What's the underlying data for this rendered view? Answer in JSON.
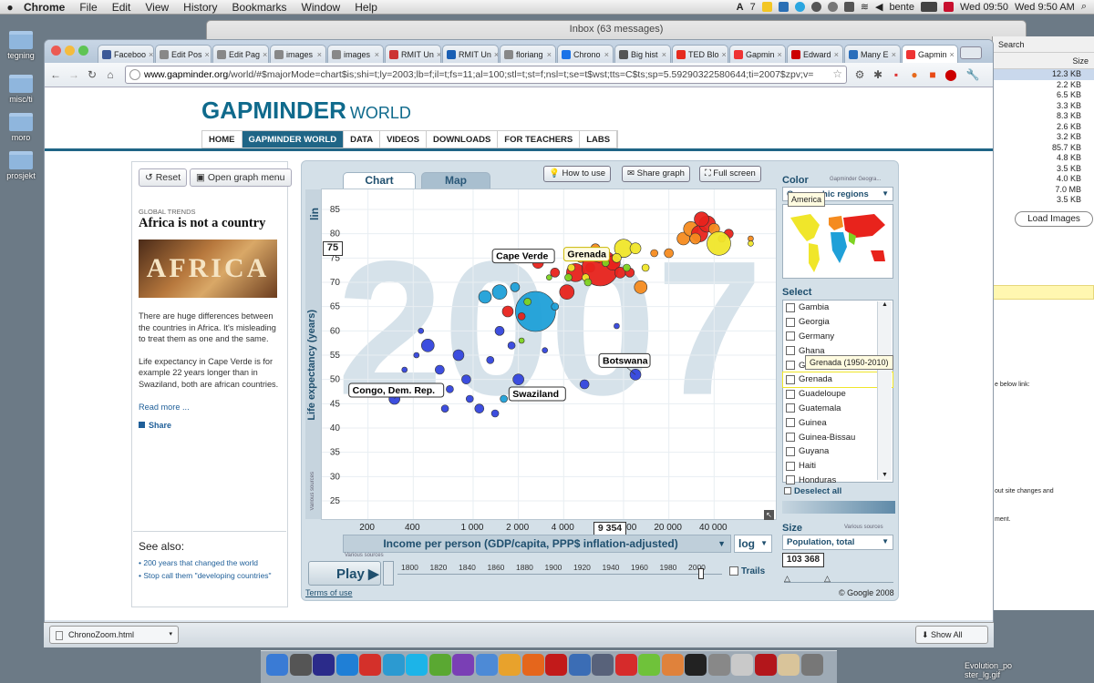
{
  "menubar": {
    "apple": "",
    "app": "Chrome",
    "items": [
      "File",
      "Edit",
      "View",
      "History",
      "Bookmarks",
      "Window",
      "Help"
    ],
    "user": "bente",
    "clock1": "Wed 09:50",
    "clock2": "Wed 9:50 AM",
    "ai_badge": "7"
  },
  "desktop": {
    "icons": [
      "tegning",
      "misc/ti",
      "moro",
      "prosjekt"
    ]
  },
  "inbox_window": {
    "title": "Inbox (63 messages)"
  },
  "finder": {
    "search": "Search",
    "size_header": "Size",
    "sizes": [
      "12.3 KB",
      "2.2 KB",
      "6.5 KB",
      "3.3 KB",
      "8.3 KB",
      "2.6 KB",
      "3.2 KB",
      "85.7 KB",
      "4.8 KB",
      "3.5 KB",
      "4.0 KB",
      "7.0 MB",
      "3.5 KB"
    ],
    "load_images": "Load Images",
    "below_link": "e below link:",
    "site_changes": "out site changes and",
    "ment": "ment.",
    "evolution": "Evolution_po\nster_lg.gif"
  },
  "tabs": [
    {
      "label": "Faceboo",
      "color": "#3b5998"
    },
    {
      "label": "Edit Pos",
      "color": "#888"
    },
    {
      "label": "Edit Pag",
      "color": "#888"
    },
    {
      "label": "images",
      "color": "#888"
    },
    {
      "label": "images",
      "color": "#888"
    },
    {
      "label": "RMIT Un",
      "color": "#c33"
    },
    {
      "label": "RMIT Un",
      "color": "#1a5fb4"
    },
    {
      "label": "floriang",
      "color": "#888"
    },
    {
      "label": "Chrono",
      "color": "#1a73e8"
    },
    {
      "label": "Big hist",
      "color": "#555"
    },
    {
      "label": "TED Blo",
      "color": "#e62b1e"
    },
    {
      "label": "Gapmin",
      "color": "#e33"
    },
    {
      "label": "Edward",
      "color": "#c00"
    },
    {
      "label": "Many E",
      "color": "#2a6ebb"
    },
    {
      "label": "Gapmin",
      "color": "#e33"
    }
  ],
  "url": {
    "host": "www.gapminder.org",
    "path": "/world/#$majorMode=chart$is;shi=t;ly=2003;lb=f;il=t;fs=11;al=100;stl=t;st=f;nsl=t;se=t$wst;tts=C$ts;sp=5.59290322580644;ti=2007$zpv;v="
  },
  "site": {
    "logo_bold": "GAPMINDER",
    "logo_light": "WORLD",
    "nav": [
      "HOME",
      "GAPMINDER WORLD",
      "DATA",
      "VIDEOS",
      "DOWNLOADS",
      "FOR TEACHERS",
      "LABS"
    ]
  },
  "left": {
    "reset": "Reset",
    "open_menu": "Open graph menu",
    "global_trends": "GLOBAL TRENDS",
    "headline": "Africa is not a country",
    "image_text": "AFRICA",
    "p1": "There are huge differences between the countries in Africa. It's misleading to treat them as one and the same.",
    "p2": "Life expectancy in Cape Verde is for example 22 years longer than in Swaziland, both are african countries.",
    "read_more": "Read more ...",
    "share": "Share",
    "see_also": "See also:",
    "links": [
      "200 years that changed the world",
      "Stop call them \"developing countries\""
    ],
    "terms": "Terms of use"
  },
  "graph": {
    "tab_chart": "Chart",
    "tab_map": "Map",
    "how_to_use": "How to use",
    "share_graph": "Share graph",
    "full_screen": "Full screen",
    "y_scale": "lin",
    "y_label": "Life expectancy (years)",
    "x_label": "Income per person (GDP/capita, PPP$ inflation-adjusted)",
    "x_scale": "log",
    "y_readout": "75",
    "x_readout": "9 354",
    "various_sources": "Various sources",
    "year": "2007",
    "play": "Play",
    "trails": "Trails",
    "timeline_ticks": [
      "1800",
      "1820",
      "1840",
      "1860",
      "1880",
      "1900",
      "1920",
      "1940",
      "1960",
      "1980",
      "2000"
    ],
    "copyright": "© Google 2008"
  },
  "chart_data": {
    "type": "scatter",
    "title": "",
    "xlabel": "Income per person (GDP/capita, PPP$ inflation-adjusted)",
    "ylabel": "Life expectancy (years)",
    "x_scale": "log",
    "xlim": [
      150,
      80000
    ],
    "ylim": [
      22,
      88
    ],
    "x_ticks": [
      "200",
      "400",
      "1 000",
      "2 000",
      "4 000",
      "10 000",
      "20 000",
      "40 000"
    ],
    "y_ticks": [
      "25",
      "30",
      "35",
      "40",
      "45",
      "50",
      "55",
      "60",
      "65",
      "70",
      "75",
      "80",
      "85"
    ],
    "year": "2007",
    "labels": [
      {
        "name": "Cape Verde",
        "x": 2700,
        "y": 74
      },
      {
        "name": "Grenada",
        "x": 7000,
        "y": 74
      },
      {
        "name": "Botswana",
        "x": 12000,
        "y": 51
      },
      {
        "name": "Swaziland",
        "x": 4000,
        "y": 46
      },
      {
        "name": "Congo, Dem. Rep.",
        "x": 300,
        "y": 46
      }
    ],
    "points": [
      {
        "x": 300,
        "y": 46,
        "r": 6,
        "c": "#3344dd"
      },
      {
        "x": 350,
        "y": 52,
        "r": 3,
        "c": "#3344dd"
      },
      {
        "x": 420,
        "y": 55,
        "r": 3,
        "c": "#3344dd"
      },
      {
        "x": 500,
        "y": 57,
        "r": 7,
        "c": "#3344dd"
      },
      {
        "x": 520,
        "y": 48,
        "r": 4,
        "c": "#3344dd"
      },
      {
        "x": 600,
        "y": 52,
        "r": 5,
        "c": "#3344dd"
      },
      {
        "x": 700,
        "y": 48,
        "r": 4,
        "c": "#3344dd"
      },
      {
        "x": 800,
        "y": 55,
        "r": 6,
        "c": "#3344dd"
      },
      {
        "x": 900,
        "y": 50,
        "r": 5,
        "c": "#3344dd"
      },
      {
        "x": 950,
        "y": 46,
        "r": 4,
        "c": "#3344dd"
      },
      {
        "x": 1100,
        "y": 44,
        "r": 5,
        "c": "#3344dd"
      },
      {
        "x": 650,
        "y": 44,
        "r": 4,
        "c": "#3344dd"
      },
      {
        "x": 450,
        "y": 60,
        "r": 3,
        "c": "#3344dd"
      },
      {
        "x": 1300,
        "y": 54,
        "r": 4,
        "c": "#3344dd"
      },
      {
        "x": 1500,
        "y": 60,
        "r": 5,
        "c": "#3344dd"
      },
      {
        "x": 1800,
        "y": 57,
        "r": 4,
        "c": "#3344dd"
      },
      {
        "x": 1400,
        "y": 43,
        "r": 4,
        "c": "#3344dd"
      },
      {
        "x": 2000,
        "y": 50,
        "r": 6,
        "c": "#3344dd"
      },
      {
        "x": 3000,
        "y": 56,
        "r": 3,
        "c": "#3344dd"
      },
      {
        "x": 5500,
        "y": 49,
        "r": 5,
        "c": "#3344dd"
      },
      {
        "x": 9000,
        "y": 61,
        "r": 3,
        "c": "#3344dd"
      },
      {
        "x": 12000,
        "y": 51,
        "r": 6,
        "c": "#3344dd"
      },
      {
        "x": 1600,
        "y": 46,
        "r": 4,
        "c": "#1fa0d8"
      },
      {
        "x": 1200,
        "y": 67,
        "r": 7,
        "c": "#1fa0d8"
      },
      {
        "x": 1500,
        "y": 68,
        "r": 8,
        "c": "#1fa0d8"
      },
      {
        "x": 2600,
        "y": 64,
        "r": 22,
        "c": "#1fa0d8"
      },
      {
        "x": 1900,
        "y": 69,
        "r": 5,
        "c": "#1fa0d8"
      },
      {
        "x": 3500,
        "y": 65,
        "r": 4,
        "c": "#1fa0d8"
      },
      {
        "x": 1700,
        "y": 64,
        "r": 6,
        "c": "#e8231c"
      },
      {
        "x": 2100,
        "y": 63,
        "r": 4,
        "c": "#e8231c"
      },
      {
        "x": 2700,
        "y": 74,
        "r": 6,
        "c": "#e8231c"
      },
      {
        "x": 3500,
        "y": 72,
        "r": 5,
        "c": "#e8231c"
      },
      {
        "x": 4200,
        "y": 68,
        "r": 8,
        "c": "#e8231c"
      },
      {
        "x": 4800,
        "y": 72,
        "r": 10,
        "c": "#e8231c"
      },
      {
        "x": 6000,
        "y": 73,
        "r": 5,
        "c": "#e8231c"
      },
      {
        "x": 7000,
        "y": 73,
        "r": 20,
        "c": "#e8231c"
      },
      {
        "x": 8500,
        "y": 74,
        "r": 8,
        "c": "#e8231c"
      },
      {
        "x": 9500,
        "y": 72,
        "r": 6,
        "c": "#e8231c"
      },
      {
        "x": 11000,
        "y": 72,
        "r": 5,
        "c": "#e8231c"
      },
      {
        "x": 13000,
        "y": 69,
        "r": 7,
        "c": "#f58b1f"
      },
      {
        "x": 5200,
        "y": 75,
        "r": 5,
        "c": "#f58b1f"
      },
      {
        "x": 6500,
        "y": 77,
        "r": 5,
        "c": "#f58b1f"
      },
      {
        "x": 16000,
        "y": 76,
        "r": 4,
        "c": "#f58b1f"
      },
      {
        "x": 20000,
        "y": 76,
        "r": 5,
        "c": "#f58b1f"
      },
      {
        "x": 25000,
        "y": 79,
        "r": 7,
        "c": "#f58b1f"
      },
      {
        "x": 28000,
        "y": 81,
        "r": 8,
        "c": "#f58b1f"
      },
      {
        "x": 32000,
        "y": 80,
        "r": 9,
        "c": "#e8231c"
      },
      {
        "x": 36000,
        "y": 82,
        "r": 9,
        "c": "#e8231c"
      },
      {
        "x": 33000,
        "y": 83,
        "r": 8,
        "c": "#e8231c"
      },
      {
        "x": 40000,
        "y": 81,
        "r": 6,
        "c": "#f58b1f"
      },
      {
        "x": 30000,
        "y": 79,
        "r": 6,
        "c": "#f58b1f"
      },
      {
        "x": 45000,
        "y": 79,
        "r": 4,
        "c": "#f58b1f"
      },
      {
        "x": 50000,
        "y": 80,
        "r": 5,
        "c": "#e8231c"
      },
      {
        "x": 70000,
        "y": 79,
        "r": 3,
        "c": "#f58b1f"
      },
      {
        "x": 70000,
        "y": 78,
        "r": 3,
        "c": "#f0e62a"
      },
      {
        "x": 43000,
        "y": 78,
        "r": 13,
        "c": "#f0e62a"
      },
      {
        "x": 10000,
        "y": 77,
        "r": 10,
        "c": "#f0e62a"
      },
      {
        "x": 12000,
        "y": 77,
        "r": 6,
        "c": "#f0e62a"
      },
      {
        "x": 14000,
        "y": 73,
        "r": 4,
        "c": "#f0e62a"
      },
      {
        "x": 9000,
        "y": 75,
        "r": 5,
        "c": "#f0e62a"
      },
      {
        "x": 5600,
        "y": 71,
        "r": 4,
        "c": "#f0e62a"
      },
      {
        "x": 4500,
        "y": 73,
        "r": 4,
        "c": "#f0e62a"
      },
      {
        "x": 3200,
        "y": 71,
        "r": 3,
        "c": "#7ed321"
      },
      {
        "x": 4300,
        "y": 71,
        "r": 4,
        "c": "#7ed321"
      },
      {
        "x": 5800,
        "y": 70,
        "r": 4,
        "c": "#7ed321"
      },
      {
        "x": 7600,
        "y": 74,
        "r": 4,
        "c": "#7ed321"
      },
      {
        "x": 2100,
        "y": 58,
        "r": 3,
        "c": "#7ed321"
      },
      {
        "x": 2300,
        "y": 66,
        "r": 4,
        "c": "#7ed321"
      },
      {
        "x": 10500,
        "y": 73,
        "r": 4,
        "c": "#7ed321"
      }
    ]
  },
  "right": {
    "color_title": "Color",
    "color_source": "Gapminder Geogra...",
    "color_select": "Geographic regions",
    "america_tip": "America",
    "select_title": "Select",
    "countries": [
      "Gambia",
      "Georgia",
      "Germany",
      "Ghana",
      "Greece",
      "Grenada",
      "Guadeloupe",
      "Guatemala",
      "Guinea",
      "Guinea-Bissau",
      "Guyana",
      "Haiti",
      "Honduras"
    ],
    "grenada_tip": "Grenada (1950-2010)",
    "deselect": "Deselect all",
    "size_title": "Size",
    "size_source": "Various sources",
    "size_select": "Population, total",
    "size_readout": "103 368"
  },
  "downloads": {
    "file": "ChronoZoom.html",
    "show_all": "Show All"
  }
}
